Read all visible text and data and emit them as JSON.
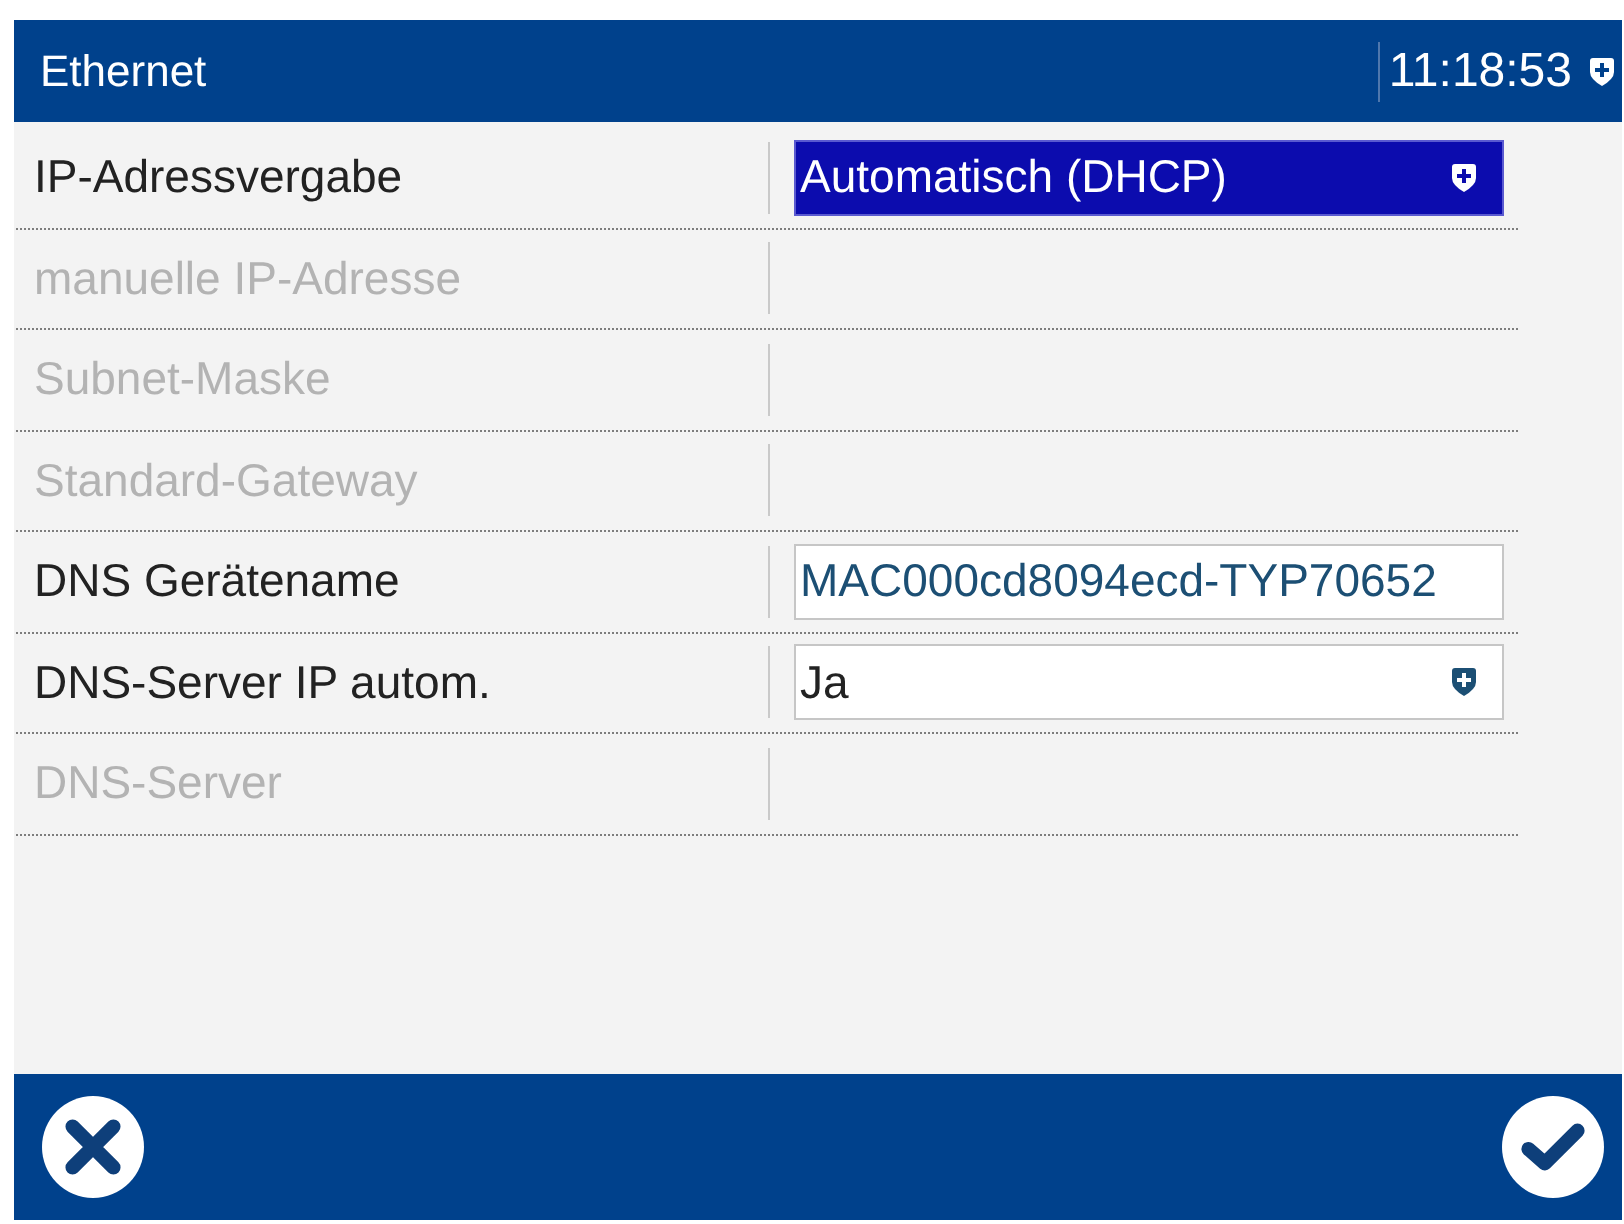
{
  "window": {
    "title": "Ethernet",
    "time": "11:18:53"
  },
  "settings": [
    {
      "label": "IP-Adressvergabe",
      "disabled": false,
      "kind": "dropdown",
      "value": "Automatisch (DHCP)",
      "selected": true
    },
    {
      "label": "manuelle IP-Adresse",
      "disabled": true,
      "kind": "empty"
    },
    {
      "label": "Subnet-Maske",
      "disabled": true,
      "kind": "empty"
    },
    {
      "label": "Standard-Gateway",
      "disabled": true,
      "kind": "empty"
    },
    {
      "label": "DNS Gerätename",
      "disabled": false,
      "kind": "text",
      "value": "MAC000cd8094ecd-TYP70652",
      "selected": false
    },
    {
      "label": "DNS-Server IP autom.",
      "disabled": false,
      "kind": "dropdown",
      "value": "Ja",
      "selected": false
    },
    {
      "label": "DNS-Server",
      "disabled": true,
      "kind": "empty"
    }
  ],
  "footer": {
    "buttons": [
      {
        "kind": "cancel"
      },
      {
        "kind": "confirm"
      }
    ]
  }
}
